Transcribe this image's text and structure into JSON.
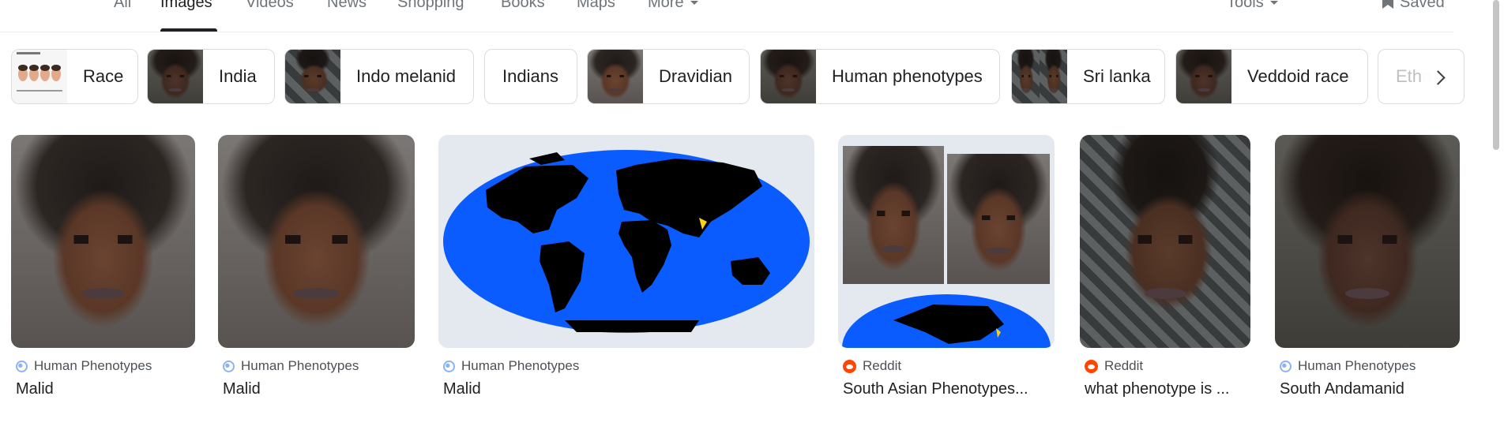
{
  "tabs": [
    {
      "label": "All",
      "active": false
    },
    {
      "label": "Images",
      "active": true
    },
    {
      "label": "Videos",
      "active": false
    },
    {
      "label": "News",
      "active": false
    },
    {
      "label": "Shopping",
      "active": false
    },
    {
      "label": "Books",
      "active": false
    },
    {
      "label": "Maps",
      "active": false
    },
    {
      "label": "More",
      "active": false
    }
  ],
  "toolbar": {
    "tools_label": "Tools",
    "saved_label": "Saved"
  },
  "chips": [
    {
      "label": "Race"
    },
    {
      "label": "India"
    },
    {
      "label": "Indo melanid"
    },
    {
      "label": "Indians"
    },
    {
      "label": "Dravidian"
    },
    {
      "label": "Human phenotypes"
    },
    {
      "label": "Sri lanka"
    },
    {
      "label": "Veddoid race"
    },
    {
      "label": "Ethn"
    }
  ],
  "results": [
    {
      "source": "Human Phenotypes",
      "source_icon": "globe-icon",
      "title": "Malid"
    },
    {
      "source": "Human Phenotypes",
      "source_icon": "globe-icon",
      "title": "Malid"
    },
    {
      "source": "Human Phenotypes",
      "source_icon": "globe-icon",
      "title": "Malid"
    },
    {
      "source": "Reddit",
      "source_icon": "reddit-icon",
      "title": "South Asian Phenotypes..."
    },
    {
      "source": "Reddit",
      "source_icon": "reddit-icon",
      "title": "what phenotype is ..."
    },
    {
      "source": "Human Phenotypes",
      "source_icon": "globe-icon",
      "title": "South Andamanid"
    }
  ],
  "colors": {
    "map_ocean": "#0b5cff",
    "map_land": "#000000",
    "map_highlight": "#f2d21b",
    "reddit": "#ff4500"
  }
}
